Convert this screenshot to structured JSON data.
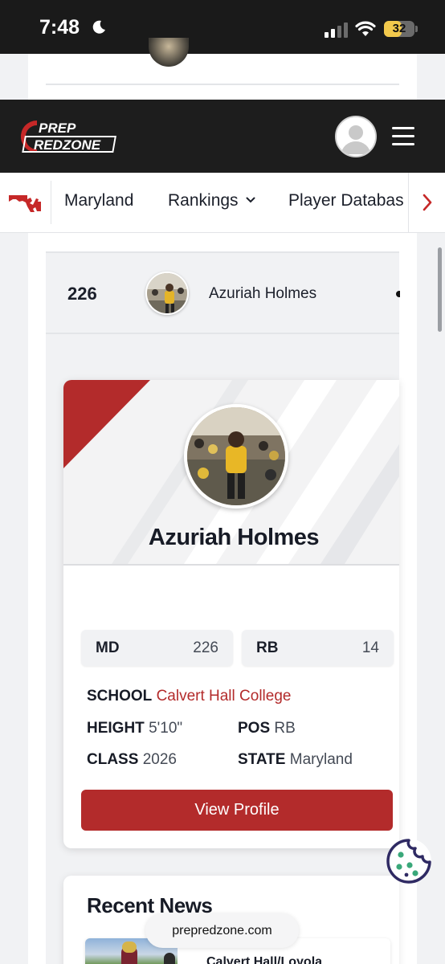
{
  "status_bar": {
    "time": "7:48",
    "battery": "32",
    "battery_level": 0.32
  },
  "header": {
    "logo_text_top": "PREP",
    "logo_text_bottom": "REDZONE"
  },
  "subnav": {
    "items": [
      {
        "label": "Maryland"
      },
      {
        "label": "Rankings",
        "chevron": "⌄"
      },
      {
        "label": "Player Databas"
      }
    ]
  },
  "rank_row": {
    "rank": "226",
    "name": "Azuriah Holmes"
  },
  "player_card": {
    "name": "Azuriah Holmes",
    "stats": [
      {
        "label": "MD",
        "value": "226"
      },
      {
        "label": "RB",
        "value": "14"
      }
    ],
    "school_label": "SCHOOL",
    "school_value": "Calvert Hall College",
    "height_label": "HEIGHT",
    "height_value": "5'10\"",
    "pos_label": "POS",
    "pos_value": "RB",
    "class_label": "CLASS",
    "class_value": "2026",
    "state_label": "STATE",
    "state_value": "Maryland",
    "view_button": "View Profile"
  },
  "news": {
    "title": "Recent News",
    "items": [
      {
        "headline": "Calvert Hall/Loyola"
      }
    ]
  },
  "browser": {
    "url": "prepredzone.com"
  },
  "colors": {
    "brand_red": "#b32b2b",
    "header_dark": "#1d1d1d",
    "cookie": "#2f2a63",
    "cookie_dots": "#3aa87a"
  },
  "icons": [
    "moon-icon",
    "signal-icon",
    "wifi-icon",
    "battery-icon",
    "user-avatar-icon",
    "hamburger-menu-icon",
    "maryland-state-icon",
    "chevron-down-icon",
    "chevron-right-icon",
    "cookie-icon"
  ]
}
